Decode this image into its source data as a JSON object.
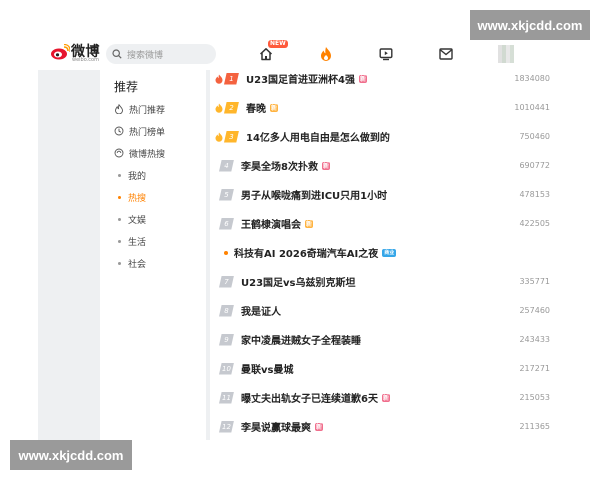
{
  "header": {
    "logo_text": "微博",
    "logo_domain": "weibo.com",
    "search_placeholder": "搜索微博",
    "new_badge": "NEW"
  },
  "watermark": {
    "top": "www.xkjcdd.com",
    "bottom": "www.xkjcdd.com"
  },
  "sidebar": {
    "title": "推荐",
    "items": [
      {
        "label": "热门推荐",
        "icon": "flame-outline-icon"
      },
      {
        "label": "热门榜单",
        "icon": "clock-outline-icon"
      },
      {
        "label": "微博热搜",
        "icon": "search-circle-icon"
      }
    ],
    "subitems": [
      {
        "label": "我的",
        "active": false
      },
      {
        "label": "热搜",
        "active": true
      },
      {
        "label": "文娱",
        "active": false
      },
      {
        "label": "生活",
        "active": false
      },
      {
        "label": "社会",
        "active": false
      }
    ]
  },
  "list": [
    {
      "rank": "1",
      "text": "U23国足首进亚洲杯4强",
      "tag": "新",
      "tag_color": "red",
      "count": "1834080"
    },
    {
      "rank": "2",
      "text": "春晚",
      "tag": "新",
      "tag_color": "orange",
      "count": "1010441"
    },
    {
      "rank": "3",
      "text": "14亿多人用电自由是怎么做到的",
      "tag": "",
      "tag_color": "",
      "count": "750460"
    },
    {
      "rank": "4",
      "text": "李昊全场8次扑救",
      "tag": "新",
      "tag_color": "red",
      "count": "690772"
    },
    {
      "rank": "5",
      "text": "男子从喉咙痛到进ICU只用1小时",
      "tag": "",
      "tag_color": "",
      "count": "478153"
    },
    {
      "rank": "6",
      "text": "王鹤棣演唱会",
      "tag": "新",
      "tag_color": "orange",
      "count": "422505"
    },
    {
      "rank": "",
      "text": "科技有AI 2026奇瑞汽车AI之夜",
      "tag": "商业",
      "tag_color": "blue",
      "count": ""
    },
    {
      "rank": "7",
      "text": "U23国足vs乌兹别克斯坦",
      "tag": "",
      "tag_color": "",
      "count": "335771"
    },
    {
      "rank": "8",
      "text": "我是证人",
      "tag": "",
      "tag_color": "",
      "count": "257460"
    },
    {
      "rank": "9",
      "text": "家中凌晨进贼女子全程装睡",
      "tag": "",
      "tag_color": "",
      "count": "243433"
    },
    {
      "rank": "10",
      "text": "曼联vs曼城",
      "tag": "",
      "tag_color": "",
      "count": "217271"
    },
    {
      "rank": "11",
      "text": "曝丈夫出轨女子已连续道歉6天",
      "tag": "新",
      "tag_color": "red",
      "count": "215053"
    },
    {
      "rank": "12",
      "text": "李昊说赢球最爽",
      "tag": "新",
      "tag_color": "red",
      "count": "211365"
    }
  ],
  "colors": {
    "accent": "#ff8200",
    "gold": "#ffb62b",
    "red": "#f4623f",
    "grey_rank": "#c6c9cf"
  }
}
